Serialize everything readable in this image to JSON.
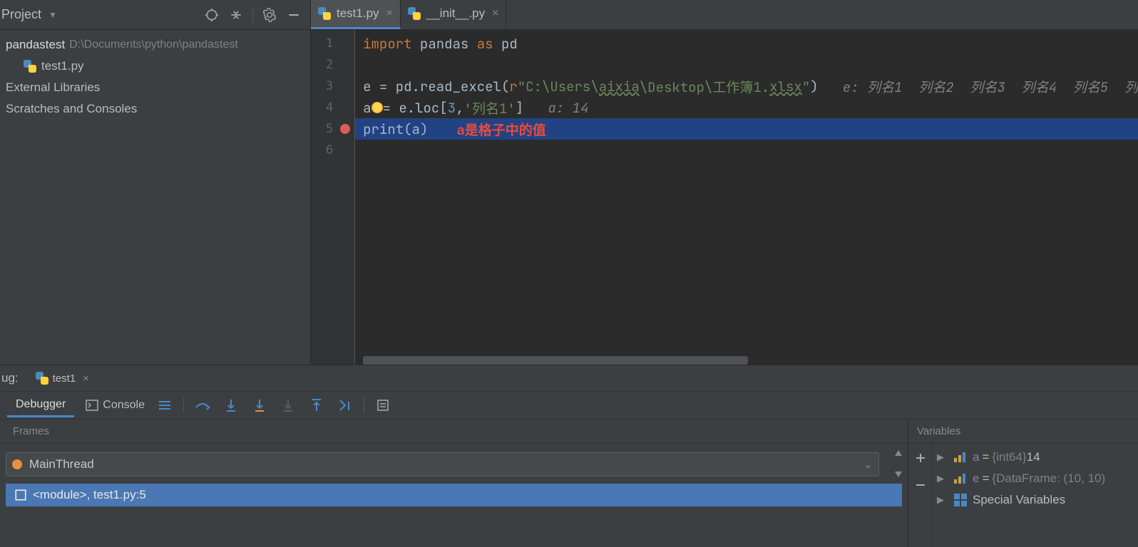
{
  "project": {
    "title": "Project",
    "root_name": "pandastest",
    "root_path": "D:\\Documents\\python\\pandastest",
    "file1": "test1.py",
    "external": "External Libraries",
    "scratches": "Scratches and Consoles"
  },
  "tabs": {
    "tab1": "test1.py",
    "tab2": "__init__.py"
  },
  "gutter": {
    "l1": "1",
    "l2": "2",
    "l3": "3",
    "l4": "4",
    "l5": "5",
    "l6": "6"
  },
  "code": {
    "l1_kw1": "import",
    "l1_id1": " pandas ",
    "l1_kw2": "as",
    "l1_id2": " pd",
    "l3_a": "e = pd.read_excel(",
    "l3_r": "r",
    "l3_str1": "\"C:\\Users\\",
    "l3_str_u1": "aixia",
    "l3_str2": "\\Desktop\\工作簿1.",
    "l3_str_u2": "xlsx",
    "l3_str3": "\"",
    "l3_b": ")",
    "l3_hint": "   e: 列名1  列名2  列名3  列名4  列名5  列",
    "l4_a": "a",
    "l4_b": "= e.loc[",
    "l4_n": "3",
    "l4_c": ",",
    "l4_str": "'列名1'",
    "l4_d": "]",
    "l4_hint": "   a: 14",
    "l5_fn": "print",
    "l5_a": "(a)",
    "l5_annot": "a是格子中的值"
  },
  "debug": {
    "title": "ug:",
    "run_tab": "test1",
    "subtab_debugger": "Debugger",
    "subtab_console": "Console",
    "frames_title": "Frames",
    "thread_name": "MainThread",
    "frame1": "<module>, test1.py:5",
    "vars_title": "Variables",
    "var_a_name": "a",
    "var_a_type": "{int64}",
    "var_a_val": " 14",
    "var_e_name": "e",
    "var_e_type": "{DataFrame: (10, 10)",
    "special": "Special Variables"
  }
}
